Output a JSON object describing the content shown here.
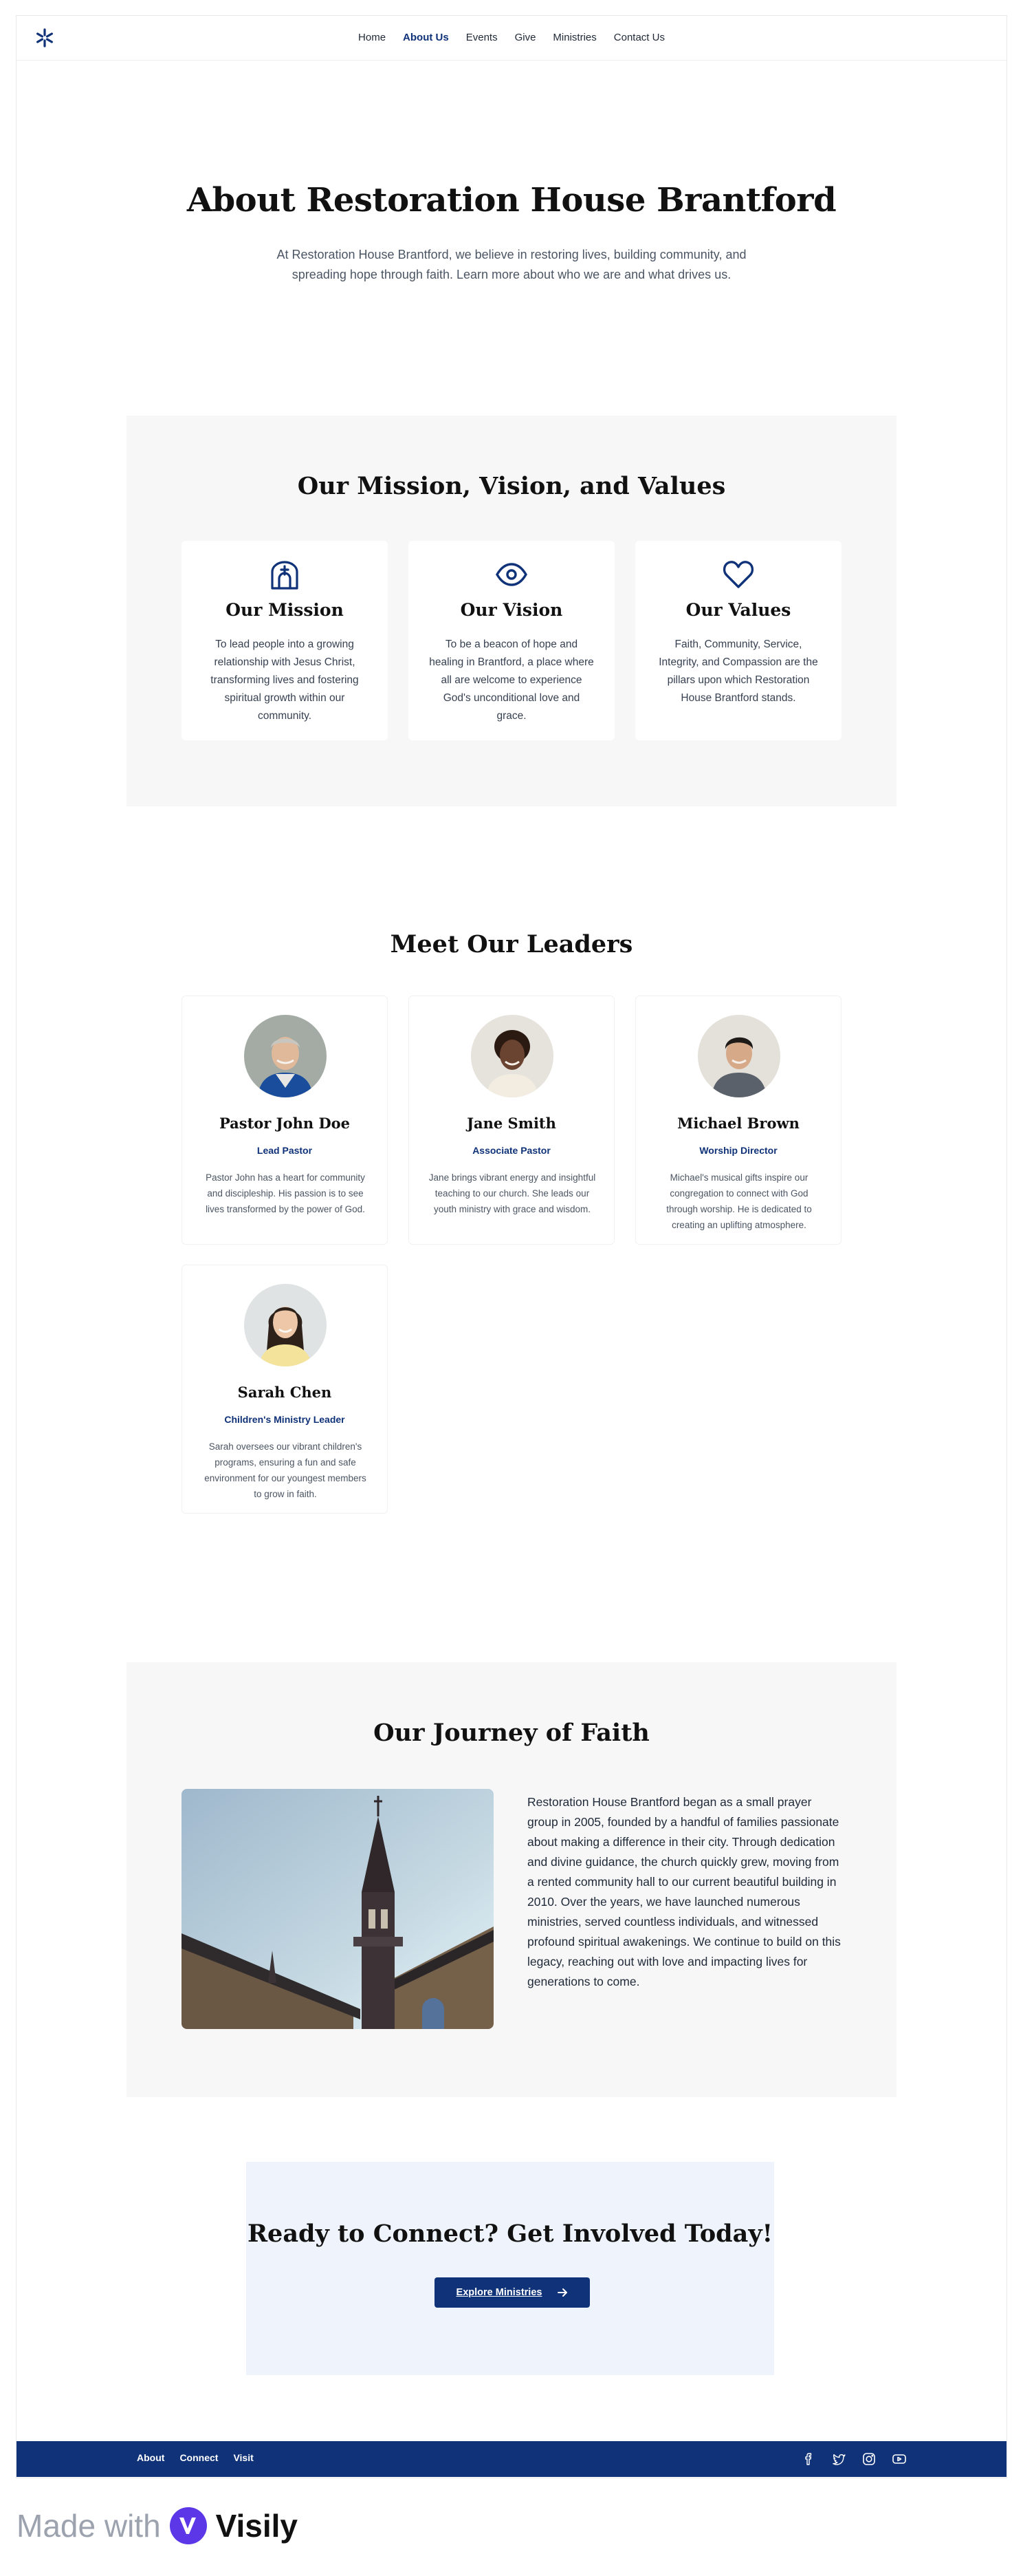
{
  "nav": {
    "items": [
      {
        "label": "Home",
        "active": false
      },
      {
        "label": "About Us",
        "active": true
      },
      {
        "label": "Events",
        "active": false
      },
      {
        "label": "Give",
        "active": false
      },
      {
        "label": "Ministries",
        "active": false
      },
      {
        "label": "Contact Us",
        "active": false
      }
    ],
    "logo_icon": "asterisk-logo-icon"
  },
  "hero": {
    "title": "About Restoration House Brantford",
    "subtitle": "At Restoration House Brantford, we believe in restoring lives, building community, and spreading hope through faith. Learn more about who we are and what drives us."
  },
  "mission": {
    "title": "Our Mission, Vision, and Values",
    "cards": [
      {
        "icon": "church-icon",
        "title": "Our Mission",
        "text": "To lead people into a growing relationship with Jesus Christ, transforming lives and fostering spiritual growth within our community."
      },
      {
        "icon": "eye-icon",
        "title": "Our Vision",
        "text": "To be a beacon of hope and healing in Brantford, a place where all are welcome to experience God's unconditional love and grace."
      },
      {
        "icon": "heart-icon",
        "title": "Our Values",
        "text": "Faith, Community, Service, Integrity, and Compassion are the pillars upon which Restoration House Brantford stands."
      }
    ]
  },
  "leaders": {
    "title": "Meet Our Leaders",
    "items": [
      {
        "name": "Pastor John Doe",
        "role": "Lead Pastor",
        "bio": "Pastor John has a heart for community and discipleship. His passion is to see lives transformed by the power of God."
      },
      {
        "name": "Jane Smith",
        "role": "Associate Pastor",
        "bio": "Jane brings vibrant energy and insightful teaching to our church. She leads our youth ministry with grace and wisdom."
      },
      {
        "name": "Michael Brown",
        "role": "Worship Director",
        "bio": "Michael's musical gifts inspire our congregation to connect with God through worship. He is dedicated to creating an uplifting atmosphere."
      },
      {
        "name": "Sarah Chen",
        "role": "Children's Ministry Leader",
        "bio": "Sarah oversees our vibrant children's programs, ensuring a fun and safe environment for our youngest members to grow in faith."
      }
    ]
  },
  "journey": {
    "title": "Our Journey of Faith",
    "text": "Restoration House Brantford began as a small prayer group in 2005, founded by a handful of families passionate about making a difference in their city. Through dedication and divine guidance, the church quickly grew, moving from a rented community hall to our current beautiful building in 2010. Over the years, we have launched numerous ministries, served countless individuals, and witnessed profound spiritual awakenings. We continue to build on this legacy, reaching out with love and impacting lives for generations to come."
  },
  "cta": {
    "title": "Ready to Connect? Get Involved Today!",
    "button_label": "Explore Ministries",
    "button_icon": "arrow-right-icon"
  },
  "footer": {
    "links": [
      "About",
      "Connect",
      "Visit"
    ],
    "social_icons": [
      "facebook-icon",
      "twitter-icon",
      "instagram-icon",
      "youtube-icon"
    ]
  },
  "badge": {
    "prefix": "Made with",
    "brand": "Visily"
  },
  "colors": {
    "brand_navy": "#0f3278",
    "panel_gray": "#f7f7f8",
    "cta_bg": "#eff4fc"
  }
}
